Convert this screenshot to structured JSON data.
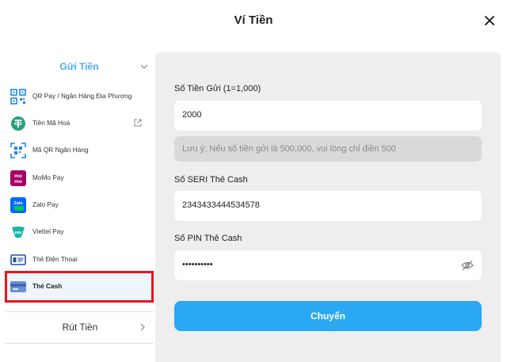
{
  "header": {
    "title": "Ví Tiền"
  },
  "sidebar": {
    "deposit_label": "Gửi Tiền",
    "items": [
      {
        "label": "QR Pay / Ngân Hàng Địa Phương",
        "icon": "qr-code-icon"
      },
      {
        "label": "Tiền Mã Hoá",
        "icon": "tether-icon"
      },
      {
        "label": "Mã QR Ngân Hàng",
        "icon": "qr-scan-icon"
      },
      {
        "label": "MoMo Pay",
        "icon": "momo-icon"
      },
      {
        "label": "Zalo Pay",
        "icon": "zalopay-icon"
      },
      {
        "label": "Viettel Pay",
        "icon": "viettelpay-icon"
      },
      {
        "label": "Thẻ Điện Thoại",
        "icon": "phone-card-icon"
      },
      {
        "label": "Thẻ Cash",
        "icon": "cash-card-icon"
      }
    ],
    "withdraw_label": "Rút Tiền"
  },
  "form": {
    "amount_label": "Số Tiền Gửi (1=1,000)",
    "amount_value": "2000",
    "note": "Lưu ý: Nếu số tiền gửi là 500,000, vui lòng chỉ điền 500",
    "serial_label": "Số SERI Thẻ Cash",
    "serial_value": "2343433444534578",
    "pin_label": "Số PIN Thẻ Cash",
    "pin_value": "••••••••••",
    "submit_label": "Chuyển"
  },
  "colors": {
    "accent": "#2aa8f2",
    "highlight": "#e8141c",
    "panel": "#eeeeee"
  }
}
